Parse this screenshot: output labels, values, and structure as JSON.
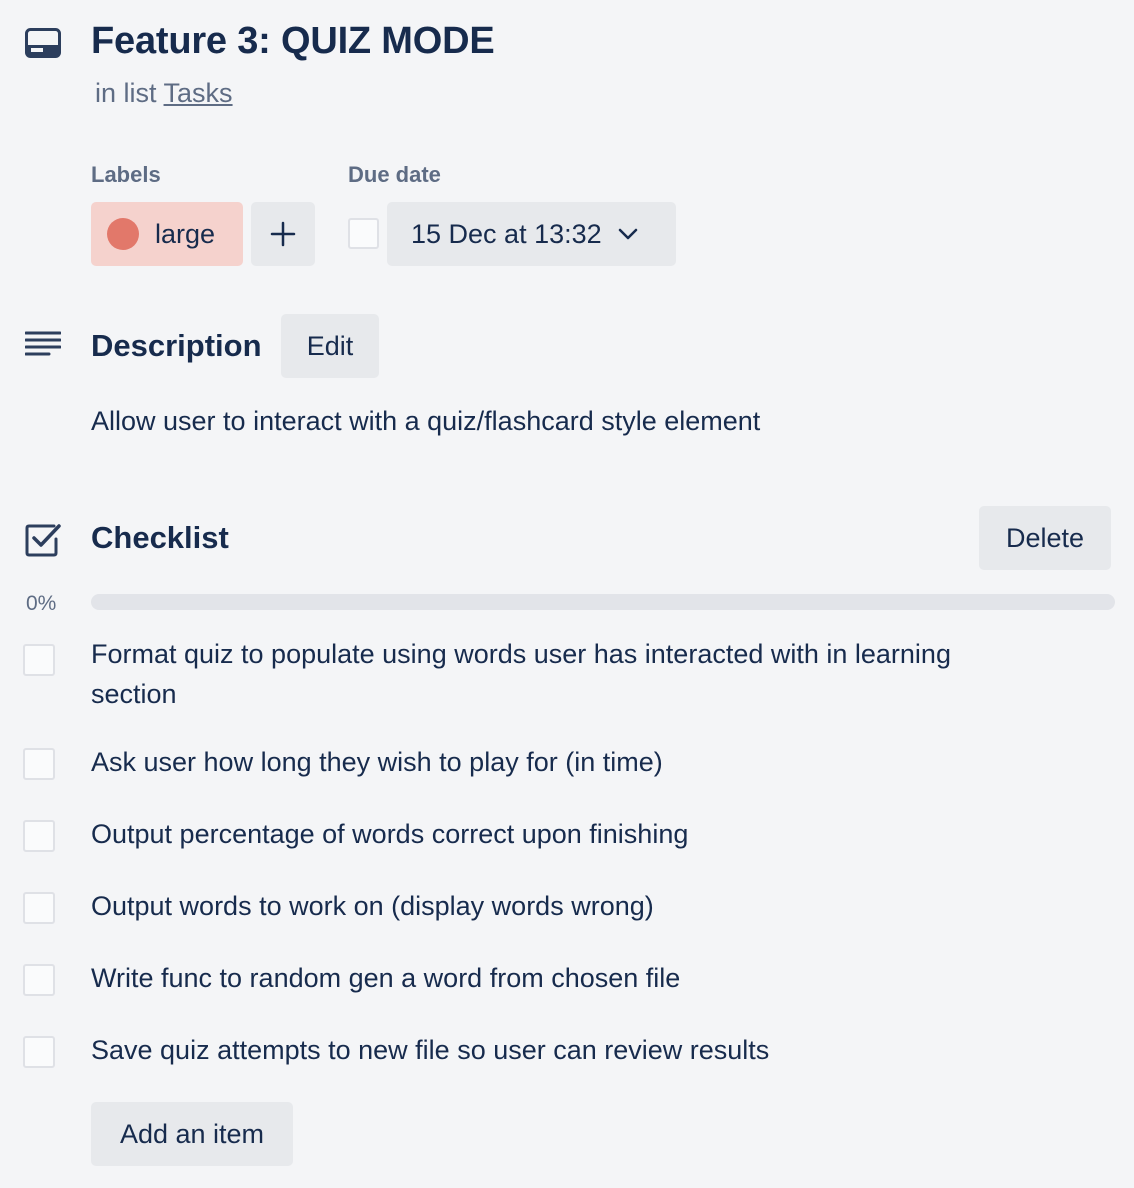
{
  "card": {
    "title": "Feature 3: QUIZ MODE",
    "in_list_prefix": "in list",
    "list_name": "Tasks"
  },
  "labels": {
    "heading": "Labels",
    "items": [
      {
        "text": "large",
        "color": "#e2786a",
        "bg": "#f5d2cd"
      }
    ],
    "add_icon": "plus-icon"
  },
  "due": {
    "heading": "Due date",
    "value": "15 Dec at 13:32",
    "completed": false,
    "chevron_icon": "chevron-down-icon"
  },
  "description": {
    "heading": "Description",
    "edit_label": "Edit",
    "text": "Allow user to interact with a quiz/flashcard style element",
    "icon": "description-lines-icon"
  },
  "checklist": {
    "heading": "Checklist",
    "delete_label": "Delete",
    "percent_text": "0%",
    "progress": 0,
    "icon": "checklist-icon",
    "items": [
      {
        "text": "Format quiz to populate using words user has interacted with in learning section",
        "checked": false
      },
      {
        "text": "Ask user how long they wish to play for (in time)",
        "checked": false
      },
      {
        "text": "Output percentage of words correct upon finishing",
        "checked": false
      },
      {
        "text": "Output words to work on (display words wrong)",
        "checked": false
      },
      {
        "text": "Write func to random gen a word from chosen file",
        "checked": false
      },
      {
        "text": "Save quiz attempts to new file so user can review results",
        "checked": false
      }
    ],
    "add_item_label": "Add an item"
  },
  "colors": {
    "text": "#172b4d",
    "muted": "#5e6c84",
    "button_bg": "#e7e9ec",
    "page_bg": "#f4f5f7"
  }
}
